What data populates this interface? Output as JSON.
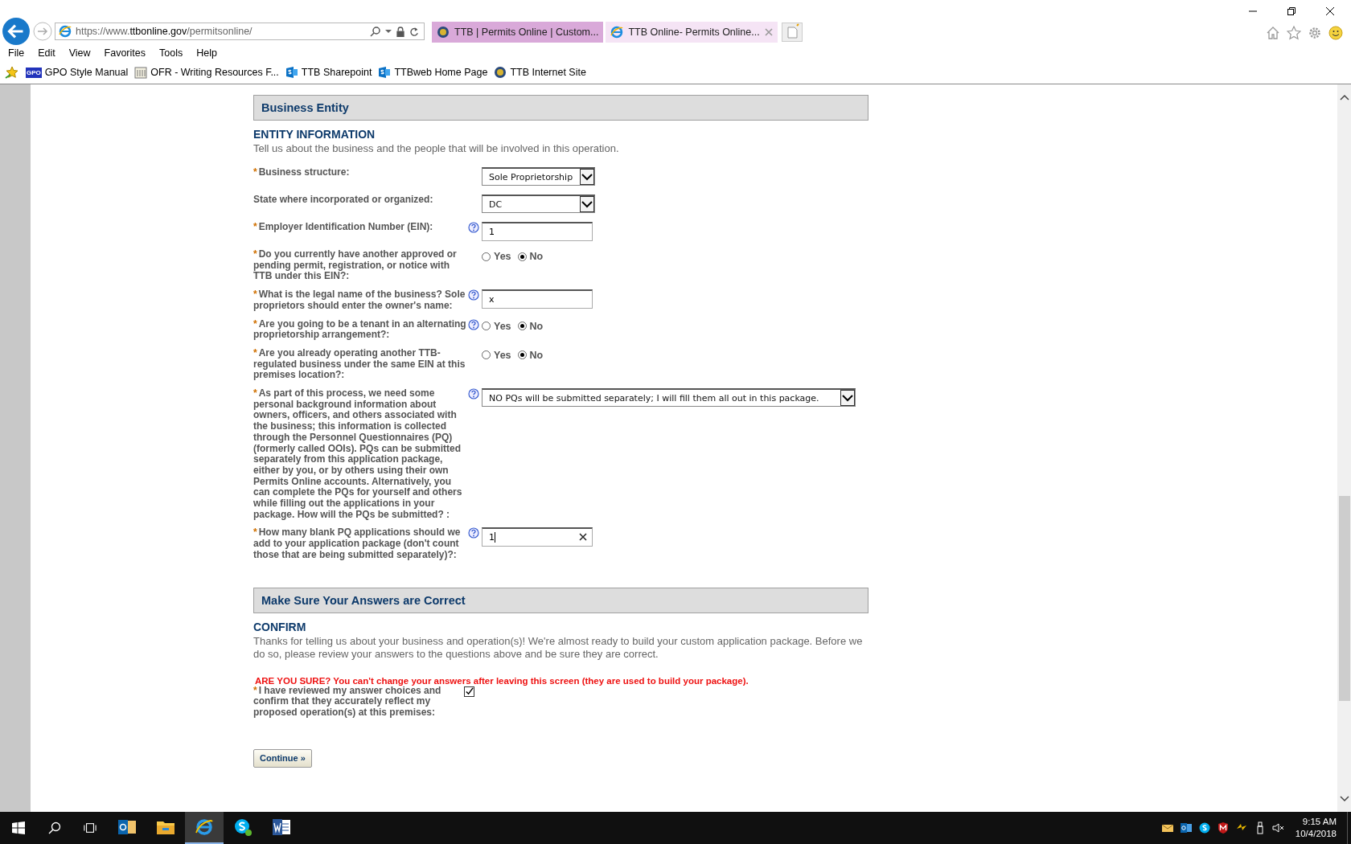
{
  "browser": {
    "address": {
      "prefix": "https://www.",
      "domain": "ttbonline.gov",
      "path": "/permitsonline/"
    },
    "tabs": [
      {
        "title": "TTB | Permits Online | Custom...",
        "kind": "seal",
        "selected": false
      },
      {
        "title": "TTB Online- Permits Online...",
        "kind": "ie",
        "selected": true
      }
    ],
    "menu": [
      "File",
      "Edit",
      "View",
      "Favorites",
      "Tools",
      "Help"
    ],
    "favorites": [
      {
        "label": "GPO Style Manual",
        "kind": "gpo",
        "icon_text": "GPO"
      },
      {
        "label": "OFR - Writing Resources F...",
        "kind": "building"
      },
      {
        "label": "TTB Sharepoint",
        "kind": "sharepoint"
      },
      {
        "label": "TTBweb Home Page",
        "kind": "sharepoint"
      },
      {
        "label": "TTB Internet Site",
        "kind": "seal"
      }
    ]
  },
  "sections": [
    {
      "header": "Business Entity",
      "subheading": "ENTITY INFORMATION",
      "intro": "Tell us about the business and the people that will be involved in this operation.",
      "questions": [
        {
          "label": "Business structure:",
          "marker": "*",
          "help": false,
          "kind": "select",
          "value": "Sole Proprietorship"
        },
        {
          "label": "State where incorporated or organized:",
          "help": false,
          "kind": "select",
          "value": "DC"
        },
        {
          "label": "Employer Identification Number (EIN):",
          "marker": "*",
          "help": true,
          "kind": "text",
          "value": "1"
        },
        {
          "label": "Do you currently have another approved or pending permit, registration, or notice with TTB under this EIN?:",
          "marker": "*",
          "help": false,
          "kind": "radio",
          "options": [
            {
              "label": "Yes",
              "selected": false
            },
            {
              "label": "No",
              "selected": true
            }
          ]
        },
        {
          "label": "What is the legal name of the business? Sole proprietors should enter the owner's name:",
          "marker": "*",
          "help": true,
          "kind": "text",
          "value": "x"
        },
        {
          "label": "Are you going to be a tenant in an alternating proprietorship arrangement?:",
          "marker": "*",
          "help": true,
          "kind": "radio",
          "options": [
            {
              "label": "Yes",
              "selected": false
            },
            {
              "label": "No",
              "selected": true
            }
          ]
        },
        {
          "label": "Are you already operating another TTB-regulated business under the same EIN at this premises location?:",
          "marker": "*",
          "help": false,
          "kind": "radio",
          "options": [
            {
              "label": "Yes",
              "selected": false
            },
            {
              "label": "No",
              "selected": true
            }
          ]
        },
        {
          "label": "As part of this process, we need some personal background information about owners, officers, and others associated with the business; this information is collected through the Personnel Questionnaires (PQ) (formerly called OOIs). PQs can be submitted separately from this application package, either by you, or by others using their own Permits Online accounts. Alternatively, you can complete the PQs for yourself and others while filling out the applications in your package. How will the PQs be submitted? :",
          "marker": "*",
          "help": true,
          "kind": "long-select",
          "value": "NO PQs will be submitted separately; I will fill them all out in this package."
        },
        {
          "label": "How many blank PQ applications should we add to your application package (don't count those that are being submitted separately)?:",
          "marker": "*",
          "help": true,
          "kind": "clearable-text",
          "value": "1"
        }
      ]
    },
    {
      "header": "Make Sure Your Answers are Correct",
      "subheading": "CONFIRM",
      "intro": "Thanks for telling us about your business and operation(s)! We're almost ready to build your custom application package. Before we do so, please review your answers to the questions above and be sure they are correct.",
      "warning": "ARE YOU SURE? You can't change your answers after leaving this screen (they are used to build your package).",
      "confirm": {
        "label": "I have reviewed my answer choices and confirm that they accurately reflect my proposed operation(s) at this premises:",
        "marker": "*",
        "checked": true
      },
      "button": "Continue »"
    }
  ],
  "taskbar": {
    "apps": [
      {
        "kind": "outlook",
        "selected": false
      },
      {
        "kind": "explorer",
        "selected": false
      },
      {
        "kind": "ie",
        "selected": true
      },
      {
        "kind": "skype",
        "selected": false
      },
      {
        "kind": "word",
        "selected": false
      }
    ],
    "time": "9:15 AM",
    "date": "10/4/2018"
  }
}
